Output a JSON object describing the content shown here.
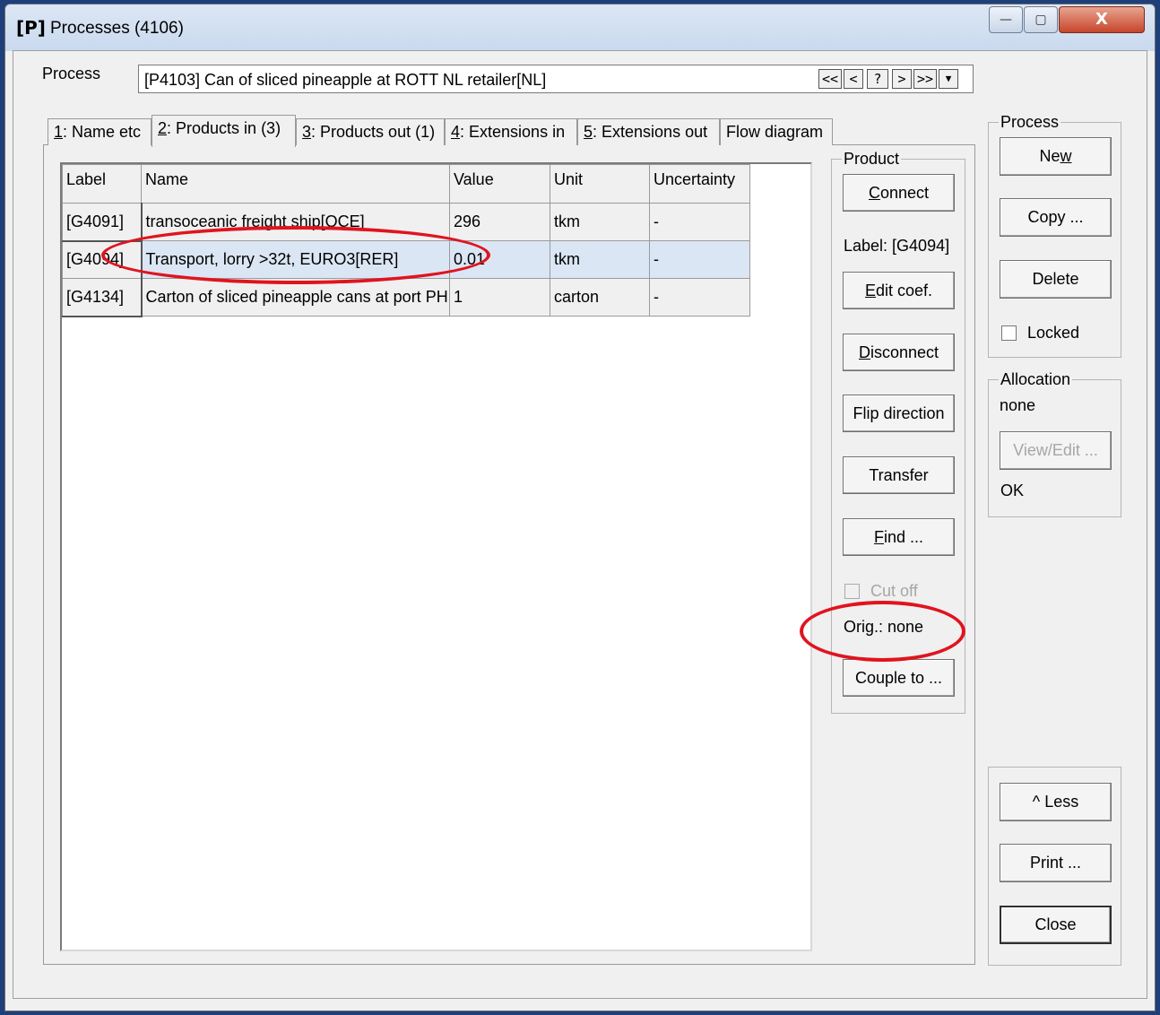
{
  "window": {
    "icon_label": "[P]",
    "title": "Processes (4106)",
    "min_glyph": "—",
    "max_glyph": "▢",
    "close_glyph": "X"
  },
  "process": {
    "label": "Process",
    "value": "[P4103] Can of sliced pineapple at ROTT NL retailer[NL]",
    "nav": [
      "<<",
      "<",
      "?",
      ">",
      ">>",
      "▼"
    ]
  },
  "tabs": [
    {
      "key": "1",
      "label": ": Name etc"
    },
    {
      "key": "2",
      "label": ": Products in (3)"
    },
    {
      "key": "3",
      "label": ": Products out (1)"
    },
    {
      "key": "4",
      "label": ": Extensions in"
    },
    {
      "key": "5",
      "label": ": Extensions out"
    },
    {
      "key": "",
      "label": "Flow diagram"
    }
  ],
  "grid": {
    "columns": [
      "Label",
      "Name",
      "Value",
      "Unit",
      "Uncertainty"
    ],
    "rows": [
      {
        "label": "[G4091]",
        "name": "transoceanic freight ship[OCE]",
        "value": "296",
        "unit": "tkm",
        "uncertainty": "-"
      },
      {
        "label": "[G4094]",
        "name": "Transport, lorry >32t, EURO3[RER]",
        "value": "0.01",
        "unit": "tkm",
        "uncertainty": "-"
      },
      {
        "label": "[G4134]",
        "name": "Carton of sliced pineapple cans at port PH",
        "value": "1",
        "unit": "carton",
        "uncertainty": "-"
      }
    ]
  },
  "product_panel": {
    "title": "Product",
    "connect": {
      "key": "C",
      "rest": "onnect"
    },
    "label_text": "Label: [G4094]",
    "edit_coef": {
      "key": "E",
      "rest": "dit coef."
    },
    "disconnect": {
      "key": "D",
      "rest": "isconnect"
    },
    "flip_direction": "Flip direction",
    "transfer": "Transfer",
    "find": {
      "key": "F",
      "rest": "ind ..."
    },
    "cut_off": "Cut off",
    "orig": "Orig.: none",
    "couple_to": "Couple to ..."
  },
  "process_panel": {
    "title": "Process",
    "new": {
      "pre": "Ne",
      "key": "w"
    },
    "copy": "Copy ...",
    "delete": "Delete",
    "locked": "Locked"
  },
  "allocation_panel": {
    "title": "Allocation",
    "value": "none",
    "view_edit": "View/Edit ...",
    "status": "OK"
  },
  "bottom_panel": {
    "less": "^ Less",
    "print": "Print ...",
    "close": "Close"
  },
  "colors": {
    "highlight_ring": "#e0141e",
    "selected_row": "#dbe6f4"
  }
}
